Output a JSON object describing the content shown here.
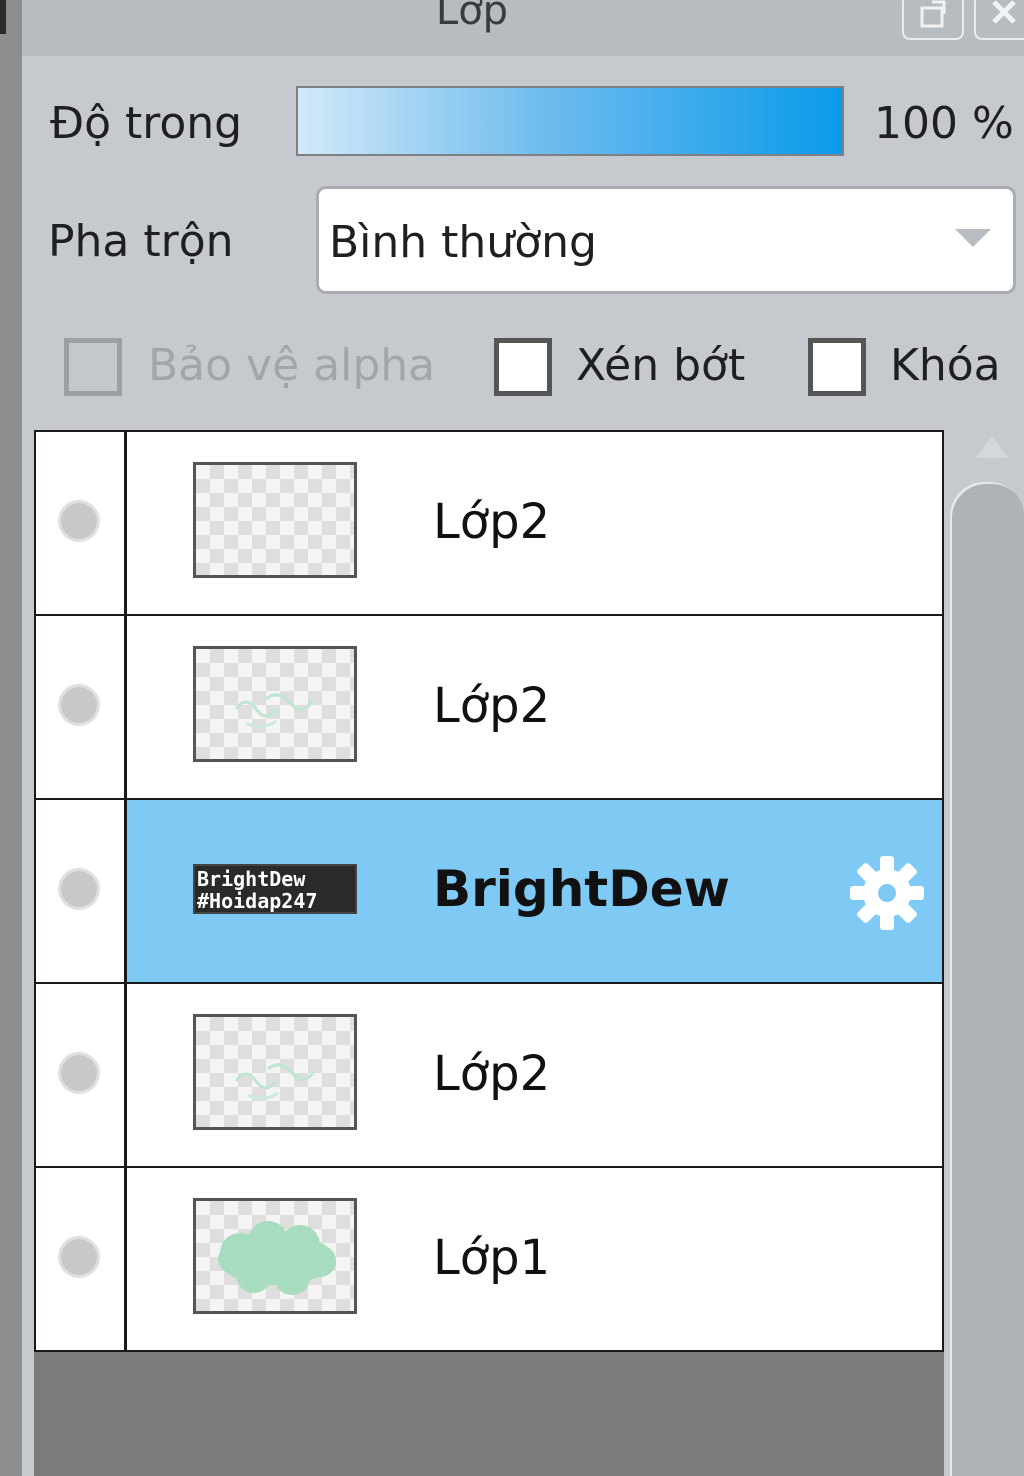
{
  "panel": {
    "title": "Lớp"
  },
  "opacity": {
    "label": "Độ trong",
    "value_text": "100 %",
    "value": 100
  },
  "blend": {
    "label": "Pha trộn",
    "selected": "Bình thường"
  },
  "options": [
    {
      "label": "Bảo vệ alpha",
      "checked": false,
      "enabled": false
    },
    {
      "label": "Xén bớt",
      "checked": false,
      "enabled": true
    },
    {
      "label": "Khóa",
      "checked": false,
      "enabled": true
    }
  ],
  "layers": [
    {
      "name": "Lớp2",
      "thumbnail": "empty-transparent",
      "selected": false
    },
    {
      "name": "Lớp2",
      "thumbnail": "faint-green-strokes",
      "selected": false
    },
    {
      "name": "BrightDew",
      "thumbnail": "text-layer",
      "thumbnail_text": [
        "BrightDew",
        "#Hoidap247"
      ],
      "selected": true,
      "icon": "gear-icon"
    },
    {
      "name": "Lớp2",
      "thumbnail": "faint-green-strokes",
      "selected": false
    },
    {
      "name": "Lớp1",
      "thumbnail": "green-blob",
      "selected": false
    }
  ],
  "colors": {
    "selected_row": "#7fcaf5",
    "panel_bg": "#c6cacf",
    "opacity_bar_end": "#0a9aea"
  }
}
